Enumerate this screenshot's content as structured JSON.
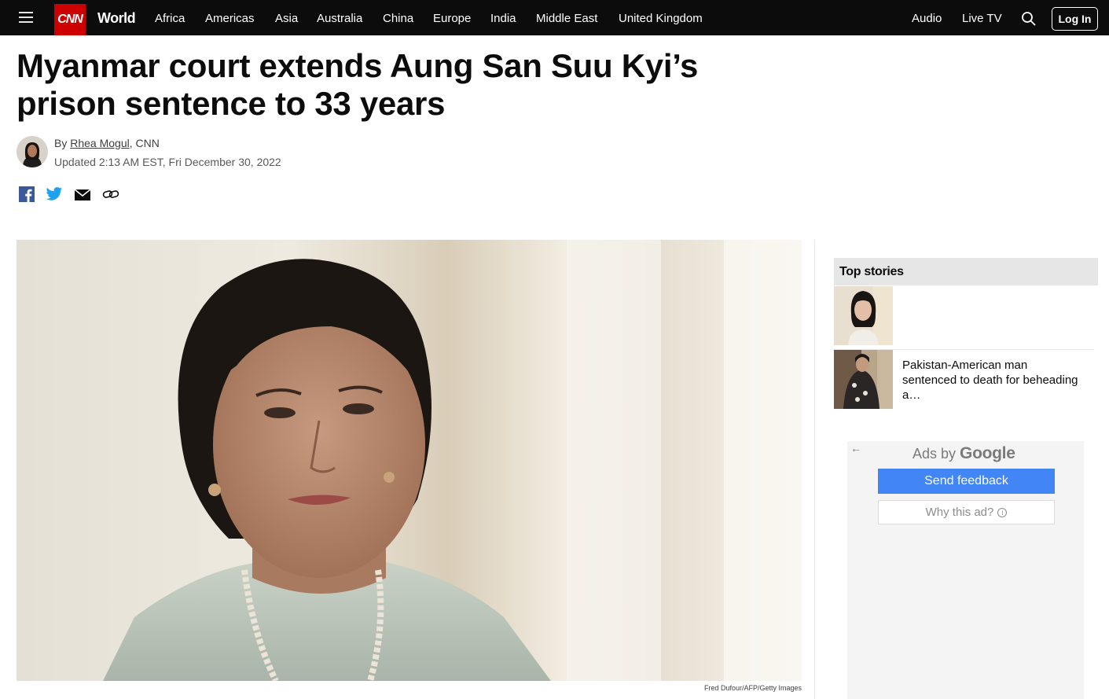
{
  "nav": {
    "logo": "CNN",
    "section": "World",
    "items": [
      "Africa",
      "Americas",
      "Asia",
      "Australia",
      "China",
      "Europe",
      "India",
      "Middle East",
      "United Kingdom"
    ],
    "right_items": [
      "Audio",
      "Live TV"
    ],
    "login_label": "Log In"
  },
  "article": {
    "headline": "Myanmar court extends Aung San Suu Kyi’s prison sentence to 33 years",
    "byline_prefix": "By",
    "author": "Rhea Mogul",
    "byline_suffix": ", CNN",
    "updated": "Updated 2:13 AM EST, Fri December 30, 2022",
    "image_credit": "Fred Dufour/AFP/Getty Images"
  },
  "share_icons": [
    "facebook-icon",
    "twitter-icon",
    "email-icon",
    "link-icon"
  ],
  "sidebar": {
    "top_stories_label": "Top stories",
    "stories": [
      {
        "title": ""
      },
      {
        "title": "Pakistan-American man sentenced to death for beheading a…"
      }
    ]
  },
  "ad": {
    "ads_by": "Ads by",
    "google": "Google",
    "send_feedback": "Send feedback",
    "why_this_ad": "Why this ad?"
  },
  "colors": {
    "nav_bg": "#0c0c0c",
    "brand_red": "#cc0000",
    "feedback_blue": "#4285f4",
    "twitter_blue": "#1da1f2",
    "facebook_blue": "#3b5998"
  }
}
